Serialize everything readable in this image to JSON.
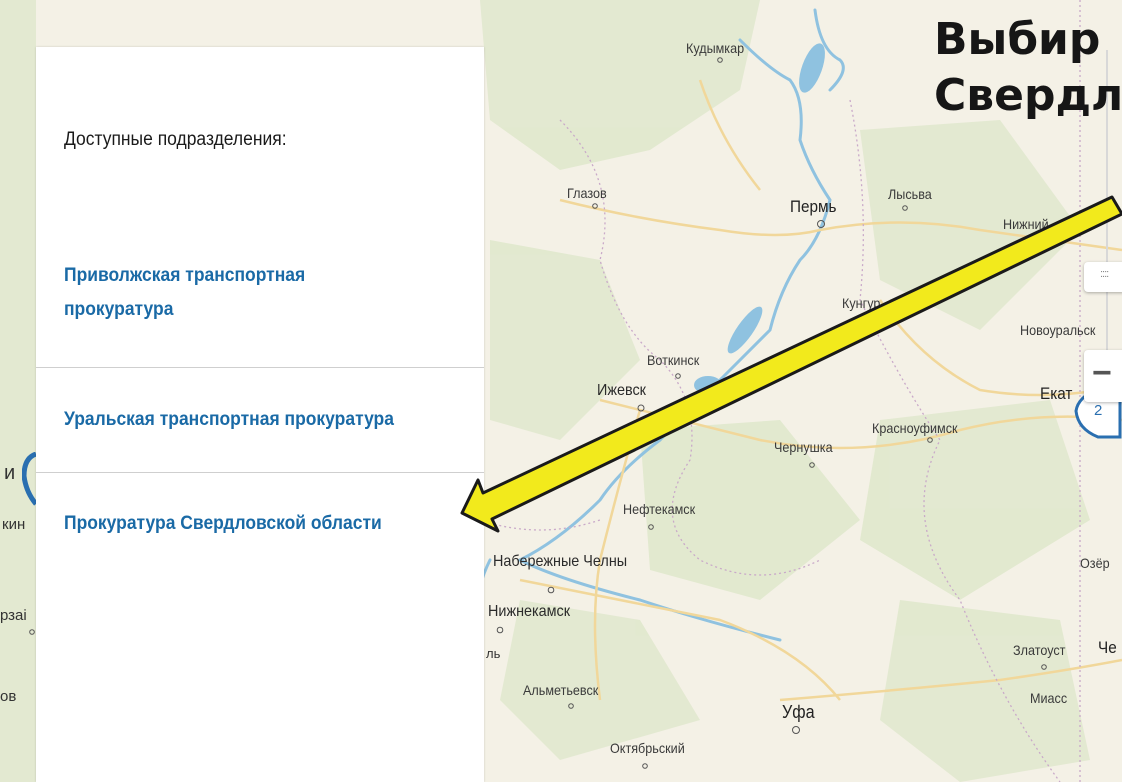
{
  "panel": {
    "title": "Доступные подразделения:",
    "items": [
      {
        "label_line1": "Приволжская транспортная",
        "label_line2": "прокуратура"
      },
      {
        "label": "Уральская транспортная прокуратура"
      },
      {
        "label": "Прокуратура Свердловской области"
      }
    ]
  },
  "headline": {
    "line1": "Выбир",
    "line2": "Свердл"
  },
  "map": {
    "cities": {
      "kudymkar": "Кудымкар",
      "glazov": "Глазов",
      "perm": "Пермь",
      "lysva": "Лысьва",
      "nizhniy": "Нижний",
      "kungur": "Кунгур",
      "novouralsk": "Новоуральск",
      "votkinsk": "Воткинск",
      "izhevsk": "Ижевск",
      "ekat": "Екат",
      "krasnoufimsk": "Красноуфимск",
      "chernushka": "Чернушка",
      "neftekamsk": "Нефтекамск",
      "chelny": "Набережные Челны",
      "nizhnekamsk": "Нижнекамск",
      "ozersk": "Озёр",
      "zlatoust": "Златоуст",
      "che": "Че",
      "almetyevsk": "Альметьевск",
      "ufa": "Уфа",
      "miass": "Миасс",
      "oktyabrsky": "Октябрьский"
    },
    "left_fragments": {
      "f1": "и",
      "f2": "кин",
      "f3": "рзаі",
      "f4": "ов",
      "f5": "ль"
    },
    "zoom_minus": "−",
    "zoom_grip": "::::",
    "zoom_badge": "2"
  },
  "colors": {
    "link": "#1a6aa6",
    "arrow_fill": "#f2ea1c",
    "water": "#8fc2e0",
    "road": "#f1d79a",
    "pin": "#2a6fb0"
  }
}
